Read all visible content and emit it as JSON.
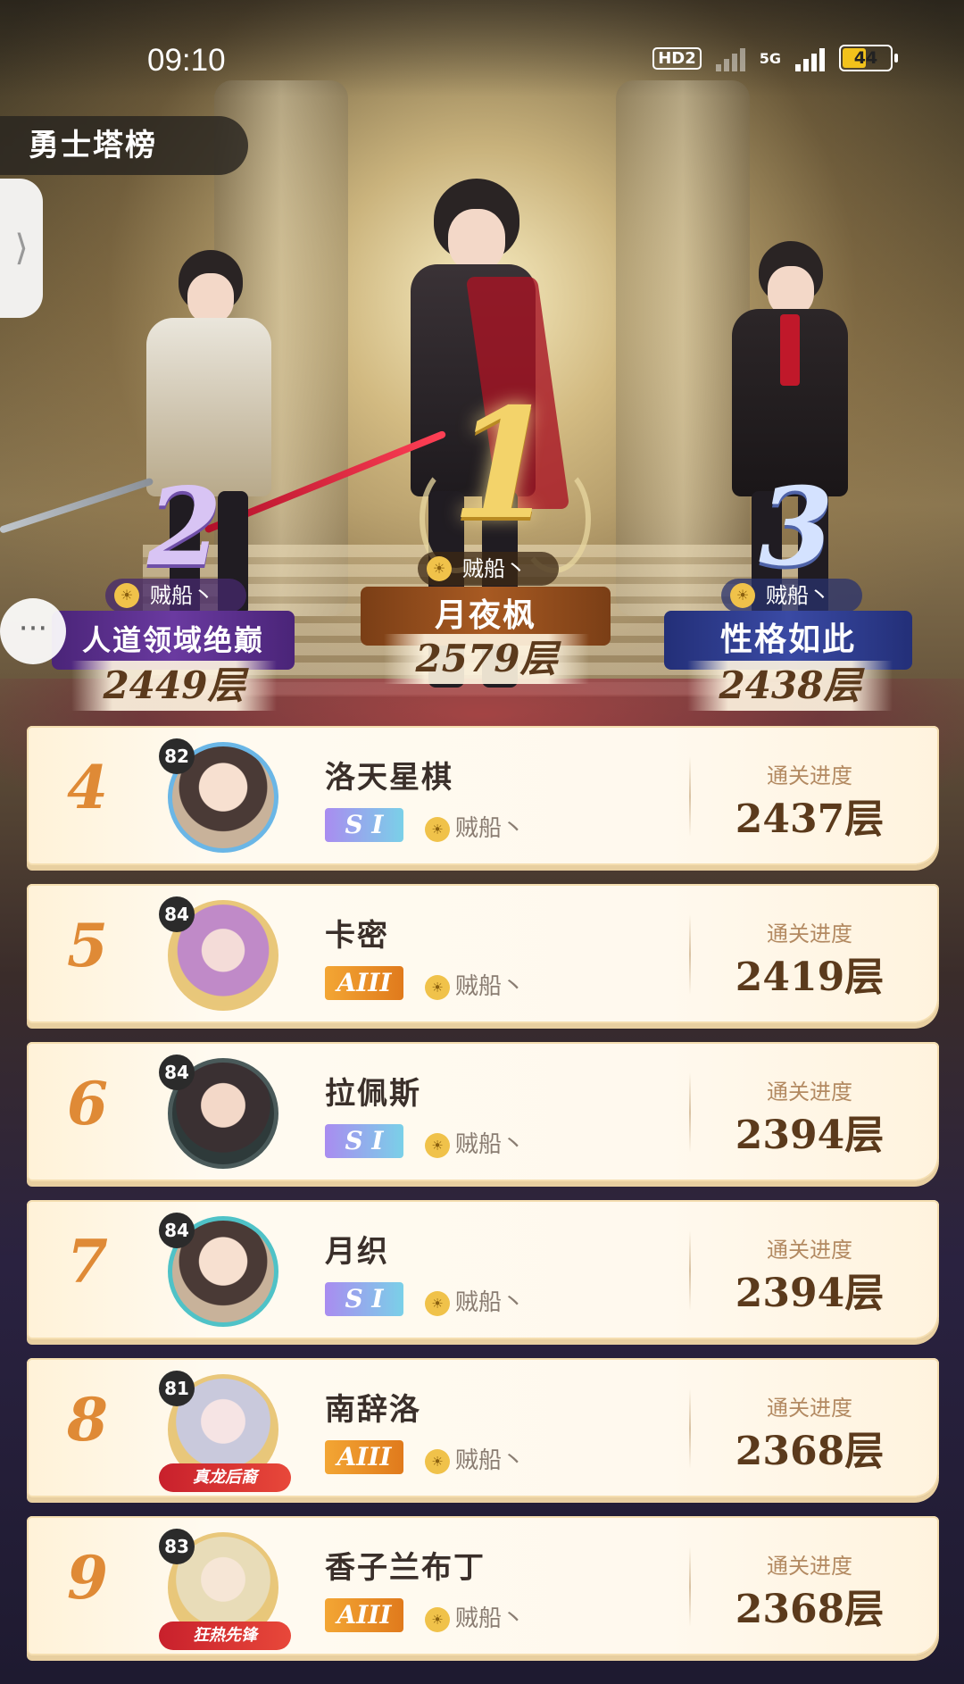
{
  "status_bar": {
    "time": "09:10",
    "hd_label": "HD2",
    "network_label": "5G",
    "battery": "44"
  },
  "page": {
    "title": "勇士塔榜",
    "side_tab_icon": "chevron-right-icon",
    "side_tab_glyph": "⟩"
  },
  "podium": [
    {
      "rank": "1",
      "clan": "贼船丶",
      "name": "月夜枫",
      "floor": "2579层"
    },
    {
      "rank": "2",
      "clan": "贼船丶",
      "name": "人道领域绝巅",
      "floor": "2449层"
    },
    {
      "rank": "3",
      "clan": "贼船丶",
      "name": "性格如此",
      "floor": "2438层"
    }
  ],
  "chat": {
    "icon": "chat-icon",
    "glyph": "···"
  },
  "list_label": "通关进度",
  "ranking": [
    {
      "rank": "4",
      "level": "82",
      "name": "洛天星棋",
      "tier": "S I",
      "clan": "贼船丶",
      "floor": "2437层",
      "badge": ""
    },
    {
      "rank": "5",
      "level": "84",
      "name": "卡密",
      "tier": "AIII",
      "clan": "贼船丶",
      "floor": "2419层",
      "badge": ""
    },
    {
      "rank": "6",
      "level": "84",
      "name": "拉佩斯",
      "tier": "S I",
      "clan": "贼船丶",
      "floor": "2394层",
      "badge": ""
    },
    {
      "rank": "7",
      "level": "84",
      "name": "月织",
      "tier": "S I",
      "clan": "贼船丶",
      "floor": "2394层",
      "badge": ""
    },
    {
      "rank": "8",
      "level": "81",
      "name": "南辞洛",
      "tier": "AIII",
      "clan": "贼船丶",
      "floor": "2368层",
      "badge": "真龙后裔"
    },
    {
      "rank": "9",
      "level": "83",
      "name": "香子兰布丁",
      "tier": "AIII",
      "clan": "贼船丶",
      "floor": "2368层",
      "badge": "狂热先锋"
    }
  ],
  "colors": {
    "rank_orange": "#df8a36",
    "podium1": "#8a4a1e",
    "podium2": "#5a2f8a",
    "podium3": "#2e3a8a",
    "tier_s": "#a98cf0",
    "tier_a": "#f3a634"
  }
}
